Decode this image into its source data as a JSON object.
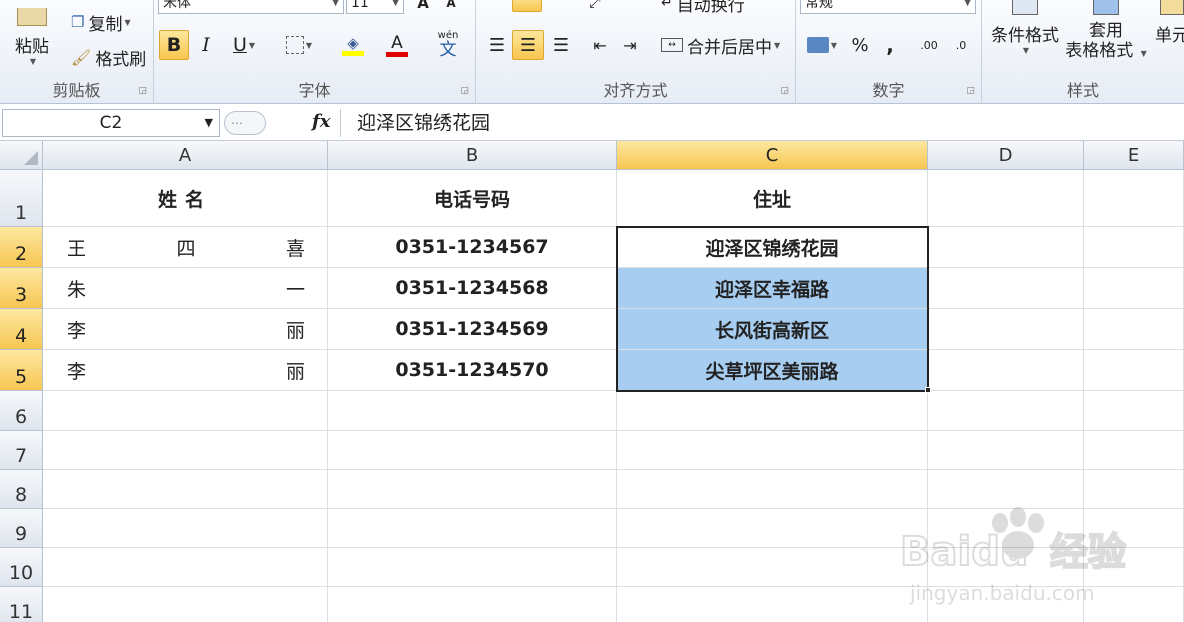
{
  "ribbon": {
    "clipboard": {
      "label": "剪贴板",
      "paste": "粘贴",
      "copy": "复制",
      "format_painter": "格式刷"
    },
    "font": {
      "label": "字体",
      "font_name": "宋体",
      "font_size": "11",
      "bold": "B",
      "italic": "I",
      "underline": "U",
      "font_color_glyph": "A",
      "phonetic": "wén"
    },
    "alignment": {
      "label": "对齐方式",
      "wrap_text": "自动换行",
      "merge_center": "合并后居中"
    },
    "number": {
      "label": "数字",
      "format": "常规",
      "percent": "%",
      "comma": ",",
      "inc_decimal": ".00",
      "dec_decimal": ".0"
    },
    "styles": {
      "label": "样式",
      "conditional": "条件格式",
      "table_format_1": "套用",
      "table_format_2": "表格格式",
      "cell_styles": "单元"
    }
  },
  "formula_bar": {
    "name_box": "C2",
    "fx": "fx",
    "value": "迎泽区锦绣花园"
  },
  "sheet": {
    "columns": [
      "A",
      "B",
      "C",
      "D",
      "E"
    ],
    "rows": [
      "1",
      "2",
      "3",
      "4",
      "5",
      "6",
      "7",
      "8",
      "9",
      "10",
      "11"
    ],
    "headers": {
      "name": "姓名",
      "phone": "电话号码",
      "address": "住址"
    },
    "records": [
      {
        "name_parts": [
          "王",
          "四",
          "喜"
        ],
        "phone": "0351-1234567",
        "address": "迎泽区锦绣花园"
      },
      {
        "name_parts": [
          "朱",
          "",
          "一"
        ],
        "phone": "0351-1234568",
        "address": "迎泽区幸福路"
      },
      {
        "name_parts": [
          "李",
          "",
          "丽"
        ],
        "phone": "0351-1234569",
        "address": "长风街高新区"
      },
      {
        "name_parts": [
          "李",
          "",
          "丽"
        ],
        "phone": "0351-1234570",
        "address": "尖草坪区美丽路"
      }
    ],
    "selection_color": "#a7cdf0",
    "header_highlight": "#f7c652"
  },
  "watermark": {
    "brand": "Baidu",
    "product": "经验",
    "url": "jingyan.baidu.com"
  }
}
